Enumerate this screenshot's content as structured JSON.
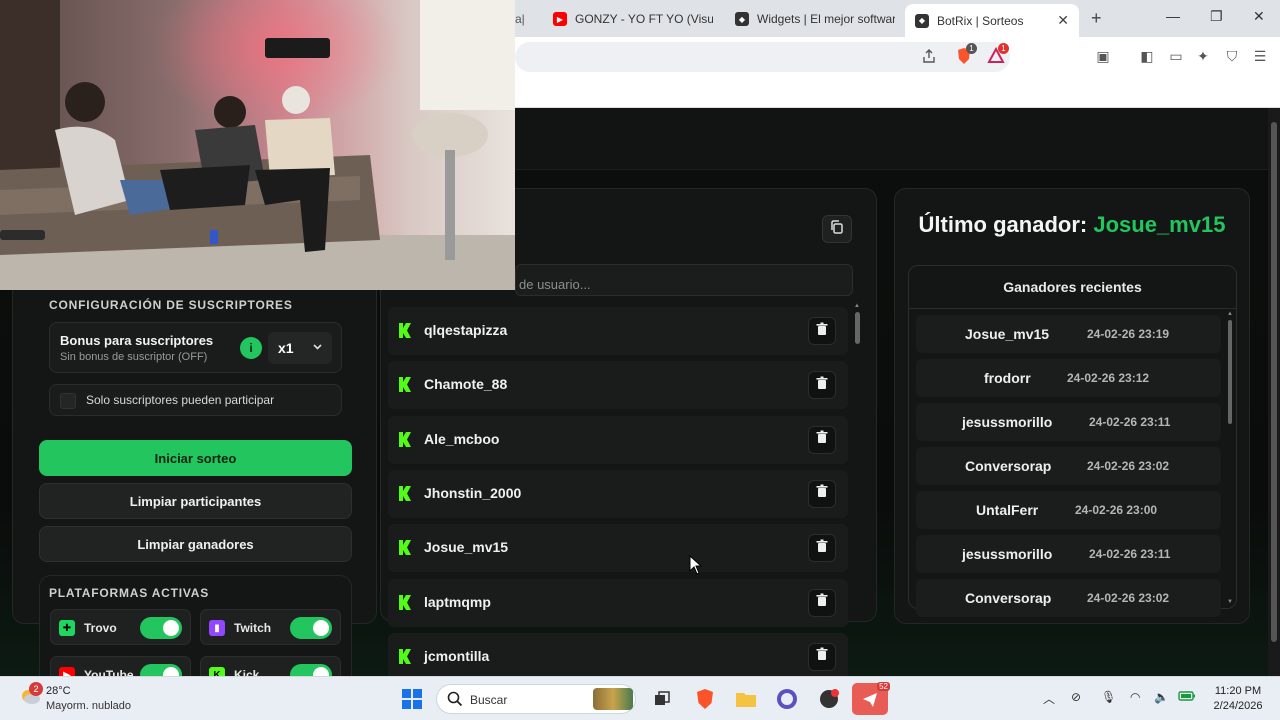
{
  "browser": {
    "tabs": [
      {
        "label": "GONZY - YO FT YO (Visual",
        "icon": "youtube-icon"
      },
      {
        "label": "Widgets | El mejor softwar",
        "icon": "botrix-icon"
      },
      {
        "label": "BotRix | Sorteos",
        "icon": "botrix-icon"
      }
    ],
    "new_tab": "+",
    "brave_badge": "1",
    "rewards_badge": "1"
  },
  "left": {
    "sub_config_title": "CONFIGURACIÓN DE SUSCRIPTORES",
    "bonus_title": "Bonus para suscriptores",
    "bonus_subtitle": "Sin bonus de suscriptor (OFF)",
    "info_icon": "i",
    "multiplier": "x1",
    "subs_only_label": "Solo suscriptores pueden participar",
    "start_button": "Iniciar sorteo",
    "clear_participants_button": "Limpiar participantes",
    "clear_winners_button": "Limpiar ganadores",
    "platforms_title": "PLATAFORMAS ACTIVAS",
    "platforms": [
      {
        "name": "Trovo",
        "enabled": true
      },
      {
        "name": "Twitch",
        "enabled": true
      },
      {
        "name": "YouTube",
        "enabled": true
      },
      {
        "name": "Kick",
        "enabled": true
      }
    ]
  },
  "middle": {
    "search_placeholder": "de usuario...",
    "participants": [
      "qlqestapizza",
      "Chamote_88",
      "Ale_mcboo",
      "Jhonstin_2000",
      "Josue_mv15",
      "laptmqmp",
      "jcmontilla"
    ]
  },
  "right": {
    "last_winner_label": "Último ganador:",
    "last_winner_name": "Josue_mv15",
    "recent_title": "Ganadores recientes",
    "recent_winners": [
      {
        "name": "Josue_mv15",
        "time": "24-02-26 23:19"
      },
      {
        "name": "frodorr",
        "time": "24-02-26 23:12"
      },
      {
        "name": "jesussmorillo",
        "time": "24-02-26 23:11"
      },
      {
        "name": "Conversorap",
        "time": "24-02-26 23:02"
      },
      {
        "name": "UntalFerr",
        "time": "24-02-26 23:00"
      },
      {
        "name": "jesussmorillo",
        "time": "24-02-26 23:11"
      },
      {
        "name": "Conversorap",
        "time": "24-02-26 23:02"
      }
    ]
  },
  "taskbar": {
    "weather_badge": "2",
    "temperature": "28°C",
    "weather": "Mayorm. nublado",
    "search_label": "Buscar",
    "app_badge": "52",
    "time": "11:20 PM",
    "date": "2/24/2026"
  },
  "colors": {
    "accent": "#22c55e",
    "page_bg": "#0b0d0c",
    "card_bg": "#141615"
  }
}
